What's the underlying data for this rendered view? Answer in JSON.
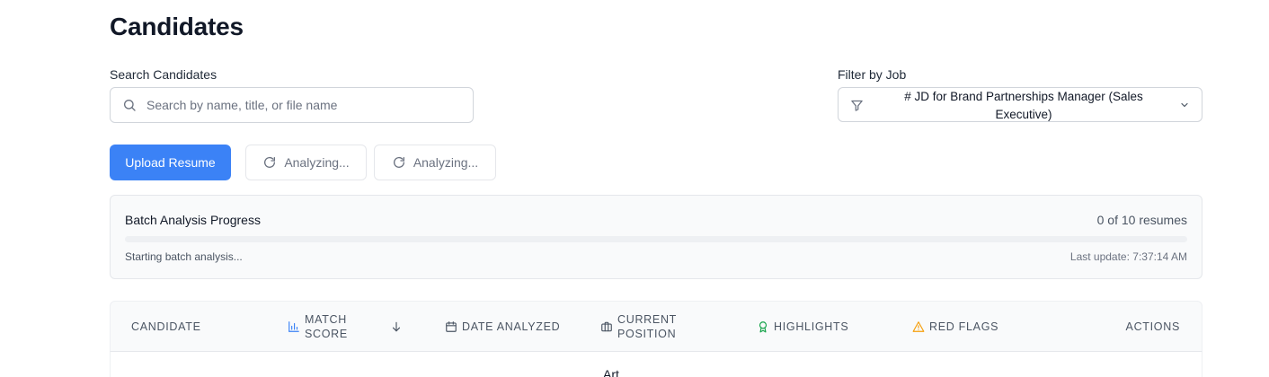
{
  "page": {
    "title": "Candidates"
  },
  "search": {
    "label": "Search Candidates",
    "placeholder": "Search by name, title, or file name",
    "value": ""
  },
  "filter": {
    "label": "Filter by Job",
    "selected": "# JD for Brand Partnerships Manager (Sales Executive)"
  },
  "actions": {
    "upload_label": "Upload Resume",
    "analyzing_1": "Analyzing...",
    "analyzing_2": "Analyzing..."
  },
  "progress": {
    "title": "Batch Analysis Progress",
    "count": "0 of 10 resumes",
    "fraction": 0,
    "status": "Starting batch analysis...",
    "last_update": "Last update: 7:37:14 AM"
  },
  "table": {
    "columns": {
      "candidate": "CANDIDATE",
      "match_score": "MATCH SCORE",
      "date_analyzed": "DATE ANALYZED",
      "current_position": "CURRENT POSITION",
      "highlights": "HIGHLIGHTS",
      "red_flags": "RED FLAGS",
      "actions": "ACTIONS"
    },
    "sort_icon": "arrow-down-icon",
    "rows": [
      {
        "current_position": "Art"
      }
    ]
  },
  "colors": {
    "primary": "#3b82f6",
    "highlight_icon": "#16a34a",
    "red_flag_icon": "#f59e0b",
    "chart_icon": "#3b82f6"
  }
}
